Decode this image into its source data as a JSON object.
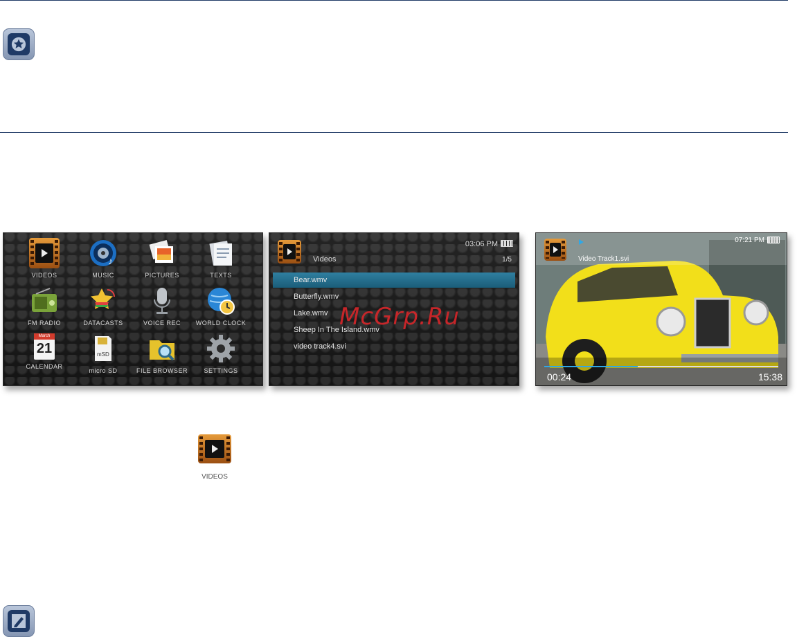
{
  "menu": {
    "items": [
      {
        "label": "VIDEOS",
        "icon": "video-film-icon"
      },
      {
        "label": "MUSIC",
        "icon": "music-speaker-icon"
      },
      {
        "label": "PICTURES",
        "icon": "pictures-icon"
      },
      {
        "label": "TEXTS",
        "icon": "texts-icon"
      },
      {
        "label": "FM RADIO",
        "icon": "radio-icon"
      },
      {
        "label": "DATACASTS",
        "icon": "datacasts-star-icon"
      },
      {
        "label": "VOICE REC",
        "icon": "microphone-icon"
      },
      {
        "label": "WORLD CLOCK",
        "icon": "globe-clock-icon"
      },
      {
        "label": "CALENDAR",
        "icon": "calendar-icon"
      },
      {
        "label": "micro SD",
        "icon": "microsd-icon"
      },
      {
        "label": "FILE BROWSER",
        "icon": "folder-search-icon"
      },
      {
        "label": "SETTINGS",
        "icon": "gear-icon"
      }
    ],
    "calendar_month": "March",
    "calendar_day": "21"
  },
  "video_list": {
    "title": "Videos",
    "time": "03:06 PM",
    "count": "1/5",
    "files": [
      "Bear.wmv",
      "Butterfly.wmv",
      "Lake.wmv",
      "Sheep In The Island.wmv",
      "video track4.svi"
    ],
    "selected_index": 0
  },
  "player": {
    "time": "07:21 PM",
    "track": "Video Track1.svi",
    "elapsed": "00:24",
    "total": "15:38",
    "progress": 0.4
  },
  "videos_icon_label": "VIDEOS",
  "watermark": "McGrp.Ru",
  "colors": {
    "accent": "#1f3a66",
    "selection": "#2f7fa0"
  }
}
